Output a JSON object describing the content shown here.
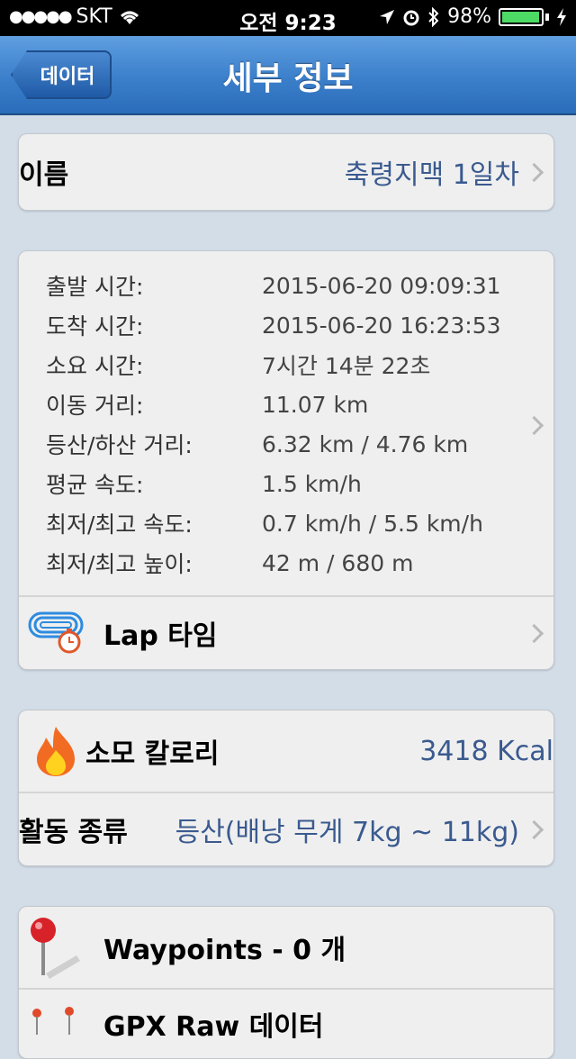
{
  "status_bar": {
    "carrier": "SKT",
    "time": "오전 9:23",
    "battery": "98%",
    "battery_level": 0.98
  },
  "nav": {
    "back_label": "데이터",
    "title": "세부 정보"
  },
  "name_row": {
    "label": "이름",
    "value": "축령지맥 1일차"
  },
  "stats": [
    {
      "label": "출발 시간:",
      "value": "2015-06-20 09:09:31"
    },
    {
      "label": "도착 시간:",
      "value": "2015-06-20 16:23:53"
    },
    {
      "label": "소요 시간:",
      "value": "7시간 14분 22초"
    },
    {
      "label": "이동 거리:",
      "value": "11.07 km"
    },
    {
      "label": "등산/하산 거리:",
      "value": "6.32 km / 4.76 km"
    },
    {
      "label": "평균 속도:",
      "value": "1.5 km/h"
    },
    {
      "label": "최저/최고 속도:",
      "value": "0.7 km/h / 5.5 km/h"
    },
    {
      "label": "최저/최고 높이:",
      "value": "42 m / 680 m"
    }
  ],
  "lap_row": {
    "label": "Lap 타임"
  },
  "calories_row": {
    "label": "소모 칼로리",
    "value": "3418 Kcal"
  },
  "activity_row": {
    "label": "활동 종류",
    "value": "등산(배낭 무게 7kg ~ 11kg)"
  },
  "waypoints_row": {
    "label": "Waypoints - 0 개"
  },
  "gpx_row": {
    "label": "GPX Raw 데이터"
  },
  "colors": {
    "accent": "#3b7fcb",
    "value_text": "#3a5a8f",
    "battery_green": "#4cd964"
  }
}
